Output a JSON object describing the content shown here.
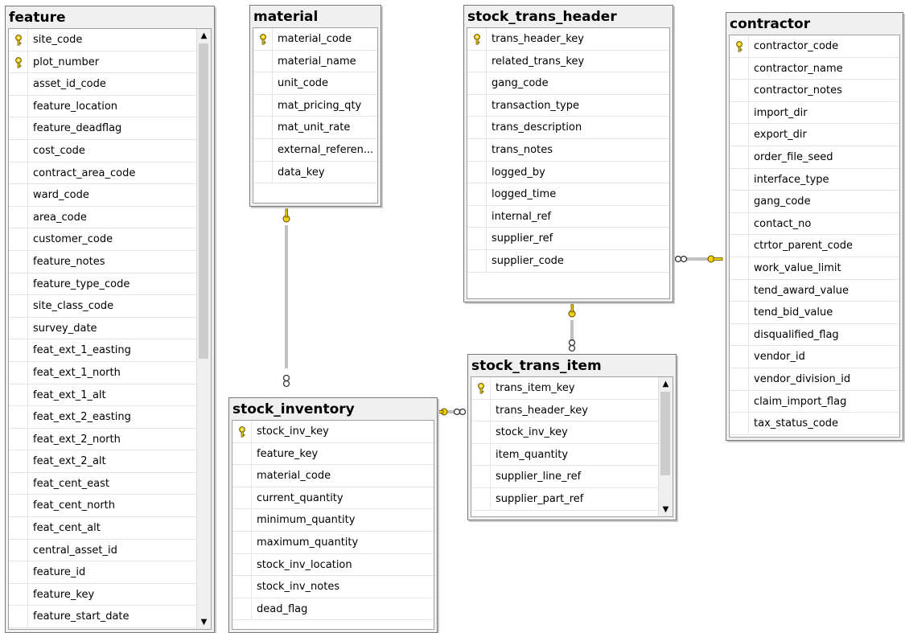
{
  "tables": {
    "feature": {
      "title": "feature",
      "columns": [
        {
          "name": "site_code",
          "pk": true
        },
        {
          "name": "plot_number",
          "pk": true
        },
        {
          "name": "asset_id_code"
        },
        {
          "name": "feature_location"
        },
        {
          "name": "feature_deadflag"
        },
        {
          "name": "cost_code"
        },
        {
          "name": "contract_area_code"
        },
        {
          "name": "ward_code"
        },
        {
          "name": "area_code"
        },
        {
          "name": "customer_code"
        },
        {
          "name": "feature_notes"
        },
        {
          "name": "feature_type_code"
        },
        {
          "name": "site_class_code"
        },
        {
          "name": "survey_date"
        },
        {
          "name": "feat_ext_1_easting"
        },
        {
          "name": "feat_ext_1_north"
        },
        {
          "name": "feat_ext_1_alt"
        },
        {
          "name": "feat_ext_2_easting"
        },
        {
          "name": "feat_ext_2_north"
        },
        {
          "name": "feat_ext_2_alt"
        },
        {
          "name": "feat_cent_east"
        },
        {
          "name": "feat_cent_north"
        },
        {
          "name": "feat_cent_alt"
        },
        {
          "name": "central_asset_id"
        },
        {
          "name": "feature_id"
        },
        {
          "name": "feature_key"
        },
        {
          "name": "feature_start_date"
        }
      ],
      "scroll_position": 0.0
    },
    "material": {
      "title": "material",
      "columns": [
        {
          "name": "material_code",
          "pk": true
        },
        {
          "name": "material_name"
        },
        {
          "name": "unit_code"
        },
        {
          "name": "mat_pricing_qty"
        },
        {
          "name": "mat_unit_rate"
        },
        {
          "name": "external_referen..."
        },
        {
          "name": "data_key"
        }
      ]
    },
    "stock_trans_header": {
      "title": "stock_trans_header",
      "columns": [
        {
          "name": "trans_header_key",
          "pk": true
        },
        {
          "name": "related_trans_key"
        },
        {
          "name": "gang_code"
        },
        {
          "name": "transaction_type"
        },
        {
          "name": "trans_description"
        },
        {
          "name": "trans_notes"
        },
        {
          "name": "logged_by"
        },
        {
          "name": "logged_time"
        },
        {
          "name": "internal_ref"
        },
        {
          "name": "supplier_ref"
        },
        {
          "name": "supplier_code"
        }
      ]
    },
    "contractor": {
      "title": "contractor",
      "columns": [
        {
          "name": "contractor_code",
          "pk": true
        },
        {
          "name": "contractor_name"
        },
        {
          "name": "contractor_notes"
        },
        {
          "name": "import_dir"
        },
        {
          "name": "export_dir"
        },
        {
          "name": "order_file_seed"
        },
        {
          "name": "interface_type"
        },
        {
          "name": "gang_code"
        },
        {
          "name": "contact_no"
        },
        {
          "name": "ctrtor_parent_code"
        },
        {
          "name": "work_value_limit"
        },
        {
          "name": "tend_award_value"
        },
        {
          "name": "tend_bid_value"
        },
        {
          "name": "disqualified_flag"
        },
        {
          "name": "vendor_id"
        },
        {
          "name": "vendor_division_id"
        },
        {
          "name": "claim_import_flag"
        },
        {
          "name": "tax_status_code"
        }
      ]
    },
    "stock_inventory": {
      "title": "stock_inventory",
      "columns": [
        {
          "name": "stock_inv_key",
          "pk": true
        },
        {
          "name": "feature_key"
        },
        {
          "name": "material_code"
        },
        {
          "name": "current_quantity"
        },
        {
          "name": "minimum_quantity"
        },
        {
          "name": "maximum_quantity"
        },
        {
          "name": "stock_inv_location"
        },
        {
          "name": "stock_inv_notes"
        },
        {
          "name": "dead_flag"
        }
      ]
    },
    "stock_trans_item": {
      "title": "stock_trans_item",
      "columns": [
        {
          "name": "trans_item_key",
          "pk": true
        },
        {
          "name": "trans_header_key"
        },
        {
          "name": "stock_inv_key"
        },
        {
          "name": "item_quantity"
        },
        {
          "name": "supplier_line_ref"
        },
        {
          "name": "supplier_part_ref"
        }
      ],
      "scroll_position": 0.0
    }
  },
  "relationships": [
    {
      "from": "material",
      "to": "stock_inventory",
      "one_end": "material",
      "many_end": "stock_inventory"
    },
    {
      "from": "stock_trans_header",
      "to": "stock_trans_item",
      "one_end": "stock_trans_header",
      "many_end": "stock_trans_item"
    },
    {
      "from": "stock_trans_header",
      "to": "contractor",
      "one_end": "contractor",
      "many_end": "stock_trans_header"
    },
    {
      "from": "stock_inventory",
      "to": "stock_trans_item",
      "one_end": "stock_inventory",
      "many_end": "stock_trans_item"
    }
  ],
  "colors": {
    "key_icon": "#f2d20c",
    "connector": "#808080"
  },
  "icons": {
    "primary_key": "key-icon",
    "scroll_up": "scroll-up-arrow-icon",
    "scroll_down": "scroll-down-arrow-icon"
  }
}
